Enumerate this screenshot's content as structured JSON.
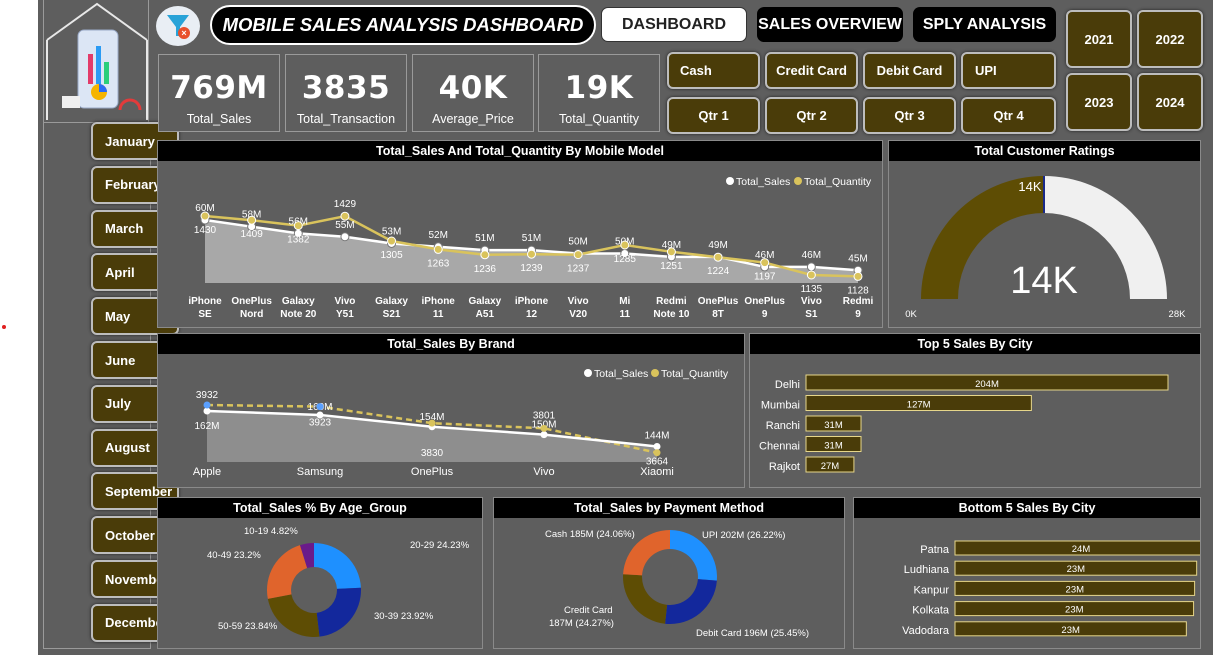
{
  "header": {
    "title": "MOBILE SALES ANALYSIS DASHBOARD"
  },
  "nav": {
    "tabs": [
      "DASHBOARD",
      "SALES OVERVIEW",
      "SPLY ANALYSIS"
    ]
  },
  "years": [
    "2021",
    "2022",
    "2023",
    "2024"
  ],
  "payment_filters": [
    "Cash",
    "Credit Card",
    "Debit Card",
    "UPI"
  ],
  "quarter_filters": [
    "Qtr 1",
    "Qtr 2",
    "Qtr 3",
    "Qtr 4"
  ],
  "months": [
    "January",
    "February",
    "March",
    "April",
    "May",
    "June",
    "July",
    "August",
    "September",
    "October",
    "November",
    "December"
  ],
  "kpis": [
    {
      "value": "769M",
      "label": "Total_Sales"
    },
    {
      "value": "3835",
      "label": "Total_Transaction"
    },
    {
      "value": "40K",
      "label": "Average_Price"
    },
    {
      "value": "19K",
      "label": "Total_Quantity"
    }
  ],
  "colors": {
    "panel": "#5e5e5e",
    "gold": "#4a3c09",
    "series_quantity": "#d9c35c",
    "series_sales": "#ffffff",
    "gauge_fill": "#5e4d04",
    "gauge_rest": "#f0f0f0"
  },
  "chart_data": [
    {
      "type": "line",
      "title": "Total_Sales And Total_Quantity By Mobile Model",
      "legend_position": "top-right",
      "categories": [
        "iPhone SE",
        "OnePlus Nord",
        "Galaxy Note 20",
        "Vivo Y51",
        "Galaxy S21",
        "iPhone 11",
        "Galaxy A51",
        "iPhone 12",
        "Vivo V20",
        "Mi 11",
        "Redmi Note 10",
        "OnePlus 8T",
        "OnePlus 9",
        "Vivo S1",
        "Redmi 9"
      ],
      "series": [
        {
          "name": "Total_Sales",
          "labels": [
            "60M",
            "58M",
            "56M",
            "55M",
            "53M",
            "52M",
            "51M",
            "51M",
            "50M",
            "50M",
            "49M",
            "49M",
            "46M",
            "46M",
            "45M"
          ],
          "values": [
            60,
            58,
            56,
            55,
            53,
            52,
            51,
            51,
            50,
            50,
            49,
            49,
            46,
            46,
            45
          ]
        },
        {
          "name": "Total_Quantity",
          "values": [
            1430,
            1409,
            1382,
            1429,
            1305,
            1263,
            1236,
            1239,
            1237,
            1285,
            1251,
            1224,
            1197,
            1135,
            1128
          ]
        }
      ]
    },
    {
      "type": "gauge",
      "title": "Total Customer Ratings",
      "value_label": "14K",
      "min_label": "0K",
      "max_label": "28K",
      "target_label": "14K",
      "value": 14,
      "min": 0,
      "max": 28
    },
    {
      "type": "line",
      "title": "Total_Sales By Brand",
      "legend_position": "top-right",
      "categories": [
        "Apple",
        "Samsung",
        "OnePlus",
        "Vivo",
        "Xiaomi"
      ],
      "series": [
        {
          "name": "Total_Sales",
          "labels": [
            "162M",
            "160M",
            "154M",
            "150M",
            "144M"
          ],
          "values": [
            162,
            160,
            154,
            150,
            144
          ]
        },
        {
          "name": "Total_Quantity",
          "values": [
            3932,
            3923,
            3830,
            3801,
            3664
          ]
        }
      ]
    },
    {
      "type": "bar",
      "title": "Top 5 Sales By City",
      "categories": [
        "Delhi",
        "Mumbai",
        "Ranchi",
        "Chennai",
        "Rajkot"
      ],
      "labels": [
        "204M",
        "127M",
        "31M",
        "31M",
        "27M"
      ],
      "values": [
        204,
        127,
        31,
        31,
        27
      ]
    },
    {
      "type": "pie",
      "title": "Total_Sales % By Age_Group",
      "slices": [
        {
          "label": "20-29 24.23%",
          "name": "20-29",
          "value": 24.23,
          "color": "#1e90ff"
        },
        {
          "label": "30-39 23.92%",
          "name": "30-39",
          "value": 23.92,
          "color": "#13289c"
        },
        {
          "label": "50-59 23.84%",
          "name": "50-59",
          "value": 23.84,
          "color": "#5e4d04"
        },
        {
          "label": "40-49 23.2%",
          "name": "40-49",
          "value": 23.2,
          "color": "#e0642c"
        },
        {
          "label": "10-19 4.82%",
          "name": "10-19",
          "value": 4.82,
          "color": "#6a1b8a"
        }
      ]
    },
    {
      "type": "pie",
      "title": "Total_Sales by Payment Method",
      "slices": [
        {
          "label": "UPI 202M (26.22%)",
          "name": "UPI",
          "value": 26.22,
          "color": "#1e90ff"
        },
        {
          "label": "Debit Card 196M (25.45%)",
          "name": "Debit Card",
          "value": 25.45,
          "color": "#13289c"
        },
        {
          "label": "187M (24.27%)",
          "label_prefix": "Credit Card",
          "name": "Credit Card",
          "value": 24.27,
          "color": "#5e4d04"
        },
        {
          "label": "Cash 185M (24.06%)",
          "name": "Cash",
          "value": 24.06,
          "color": "#e0642c"
        }
      ]
    },
    {
      "type": "bar",
      "title": "Bottom 5 Sales By City",
      "categories": [
        "Patna",
        "Ludhiana",
        "Kanpur",
        "Kolkata",
        "Vadodara"
      ],
      "labels": [
        "24M",
        "23M",
        "23M",
        "23M",
        "23M"
      ],
      "values": [
        24.4,
        23.4,
        23.2,
        23.1,
        22.4
      ]
    }
  ]
}
